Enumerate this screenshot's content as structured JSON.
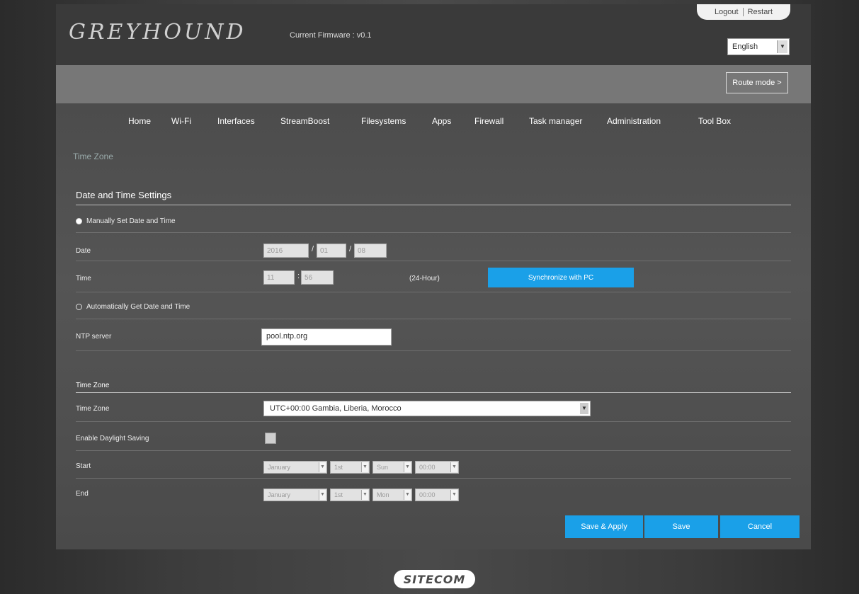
{
  "header": {
    "logo": "GREYHOUND",
    "firmware": "Current Firmware : v0.1",
    "logout": "Logout",
    "restart": "Restart",
    "language": "English",
    "route_mode": "Route mode >"
  },
  "nav": {
    "items": [
      "Home",
      "Wi-Fi",
      "Interfaces",
      "StreamBoost",
      "Filesystems",
      "Apps",
      "Firewall",
      "Task manager",
      "Administration",
      "Tool Box"
    ]
  },
  "page": {
    "title": "Time Zone",
    "date_time": {
      "section_title": "Date and Time Settings",
      "manual_label": "Manually Set Date and Time",
      "date_label": "Date",
      "date_year": "2016",
      "date_month": "01",
      "date_day": "08",
      "time_label": "Time",
      "time_hour": "11",
      "time_minute": "56",
      "hour_format": "(24-Hour)",
      "sync_button": "Synchronize with PC",
      "auto_label": "Automatically Get Date and Time",
      "ntp_label": "NTP server",
      "ntp_value": "pool.ntp.org"
    },
    "time_zone": {
      "section_title": "Time Zone",
      "tz_label": "Time Zone",
      "tz_value": "UTC+00:00 Gambia, Liberia, Morocco",
      "dst_label": "Enable Daylight Saving",
      "start_label": "Start",
      "start_month": "January",
      "start_week": "1st",
      "start_day": "Sun",
      "start_time": "00:00",
      "end_label": "End",
      "end_month": "January",
      "end_week": "1st",
      "end_day": "Mon",
      "end_time": "00:00"
    },
    "buttons": {
      "save_apply": "Save & Apply",
      "save": "Save",
      "cancel": "Cancel"
    }
  },
  "footer": {
    "brand": "SITECOM"
  }
}
